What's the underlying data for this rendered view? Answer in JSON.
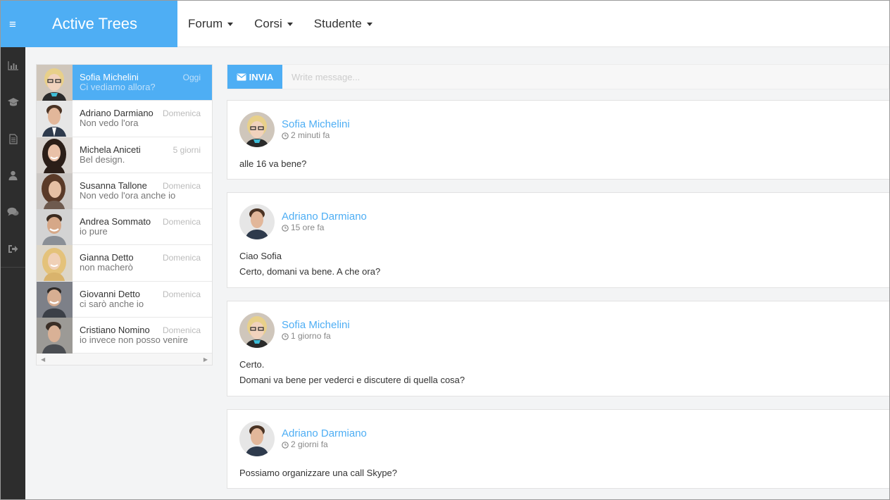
{
  "app": {
    "title": "Active Trees",
    "menu_icon": "hamburger-icon",
    "accent": "#4eaef4"
  },
  "nav": {
    "items": [
      {
        "label": "Forum"
      },
      {
        "label": "Corsi"
      },
      {
        "label": "Studente"
      }
    ]
  },
  "sidebar": {
    "icons": [
      "bar-chart-icon",
      "graduation-cap-icon",
      "document-icon",
      "user-icon",
      "chat-icon",
      "sign-out-icon"
    ]
  },
  "conversations": [
    {
      "name": "Sofia Michelini",
      "preview": "Ci vediamo allora?",
      "when": "Oggi",
      "active": true
    },
    {
      "name": "Adriano Darmiano",
      "preview": "Non vedo l'ora",
      "when": "Domenica"
    },
    {
      "name": "Michela Aniceti",
      "preview": "Bel design.",
      "when": "5 giorni"
    },
    {
      "name": "Susanna Tallone",
      "preview": "Non vedo l'ora anche io",
      "when": "Domenica"
    },
    {
      "name": "Andrea Sommato",
      "preview": "io pure",
      "when": "Domenica"
    },
    {
      "name": "Gianna Detto",
      "preview": "non macherò",
      "when": "Domenica"
    },
    {
      "name": "Giovanni Detto",
      "preview": "ci sarò anche io",
      "when": "Domenica"
    },
    {
      "name": "Cristiano Nomino",
      "preview": "io invece non posso venire",
      "when": "Domenica"
    }
  ],
  "compose": {
    "send_label": "INVIA",
    "placeholder": "Write message..."
  },
  "messages": [
    {
      "author": "Sofia Michelini",
      "time": "2 minuti fa",
      "lines": [
        "alle 16 va bene?"
      ]
    },
    {
      "author": "Adriano Darmiano",
      "time": "15 ore fa",
      "lines": [
        "Ciao Sofia",
        "Certo, domani va bene. A che ora?"
      ]
    },
    {
      "author": "Sofia Michelini",
      "time": "1 giorno fa",
      "lines": [
        "Certo.",
        "Domani va bene per vederci e discutere di quella cosa?"
      ]
    },
    {
      "author": "Adriano Darmiano",
      "time": "2 giorni fa",
      "lines": [
        "Possiamo organizzare una call Skype?"
      ]
    }
  ]
}
